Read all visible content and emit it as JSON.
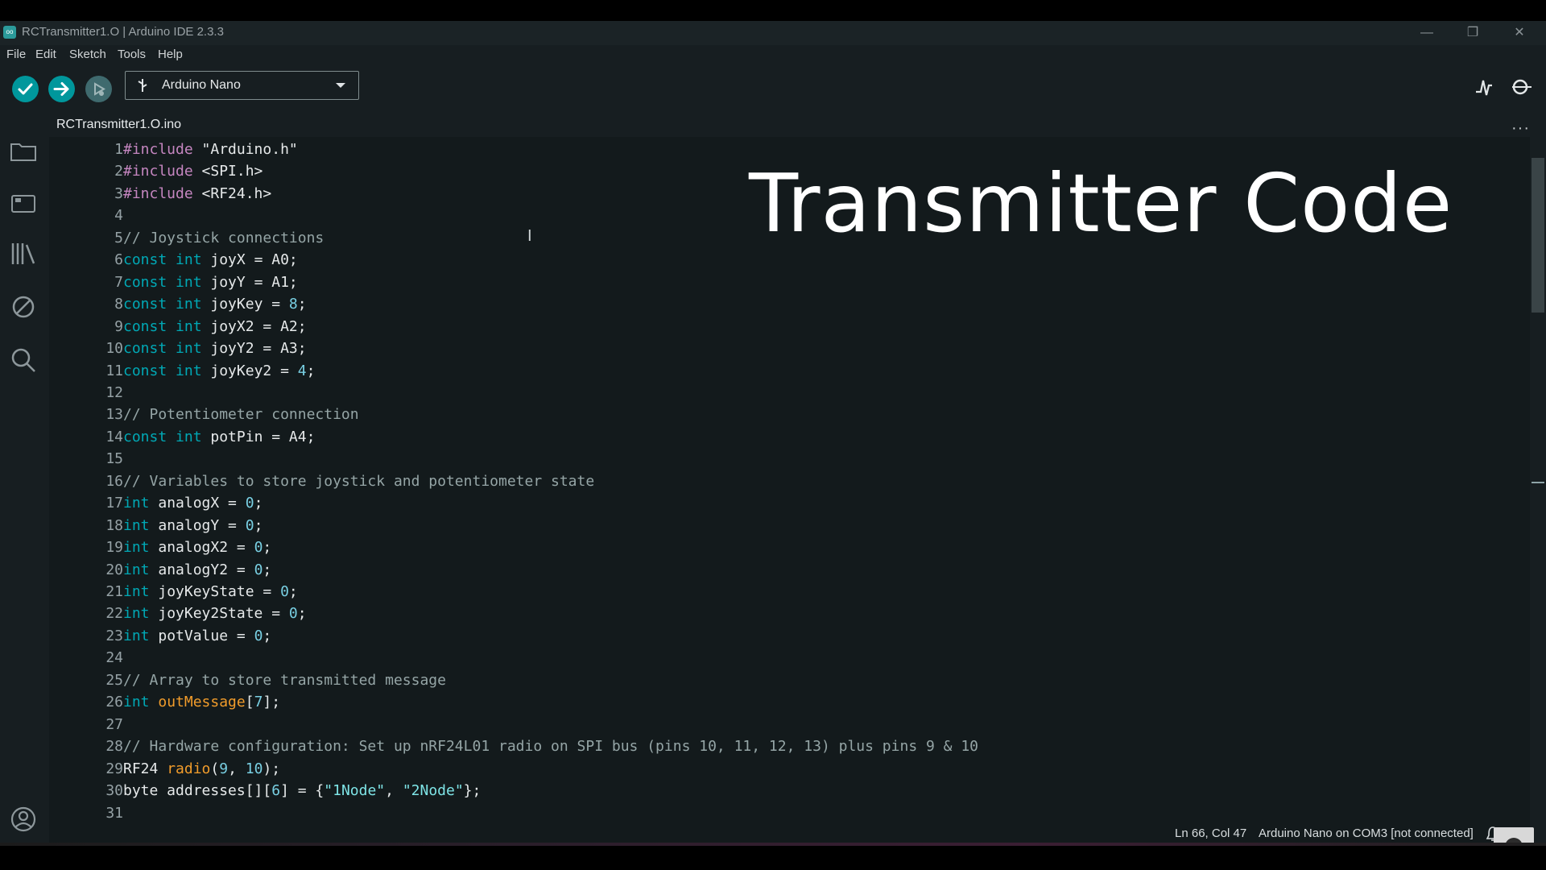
{
  "window": {
    "title": "RCTransmitter1.O | Arduino IDE 2.3.3",
    "logo_text": "oo",
    "controls": [
      "minimize",
      "restore",
      "close"
    ]
  },
  "menu": [
    "File",
    "Edit",
    "Sketch",
    "Tools",
    "Help"
  ],
  "toolbar": {
    "verify_icon": "check-icon",
    "upload_icon": "arrow-right-icon",
    "debug_icon": "debug-icon",
    "board": "Arduino Nano",
    "serial_plotter_icon": "serial-plotter-icon",
    "serial_monitor_icon": "serial-monitor-icon"
  },
  "sidebar": {
    "icons": [
      "folder-icon",
      "boards-manager-icon",
      "library-icon",
      "debug-disabled-icon",
      "search-icon",
      "account-icon"
    ]
  },
  "tab": {
    "label": "RCTransmitter1.O.ino"
  },
  "overlay": {
    "title": "Transmitter Code"
  },
  "editor": {
    "line_numbers": [
      "1",
      "2",
      "3",
      "4",
      "5",
      "6",
      "7",
      "8",
      "9",
      "10",
      "11",
      "12",
      "13",
      "14",
      "15",
      "16",
      "17",
      "18",
      "19",
      "20",
      "21",
      "22",
      "23",
      "24",
      "25",
      "26",
      "27",
      "28",
      "29",
      "30",
      "31"
    ],
    "lines": [
      [
        {
          "t": "#include",
          "c": "kw-pre"
        },
        {
          "t": " \"Arduino.h\"",
          "c": ""
        }
      ],
      [
        {
          "t": "#include",
          "c": "kw-pre"
        },
        {
          "t": " <SPI.h>",
          "c": ""
        }
      ],
      [
        {
          "t": "#include",
          "c": "kw-pre"
        },
        {
          "t": " <RF24.h>",
          "c": ""
        }
      ],
      [],
      [
        {
          "t": "// Joystick connections",
          "c": "com"
        }
      ],
      [
        {
          "t": "const int",
          "c": "kw-type"
        },
        {
          "t": " joyX = A0;",
          "c": ""
        }
      ],
      [
        {
          "t": "const int",
          "c": "kw-type"
        },
        {
          "t": " joyY = A1;",
          "c": ""
        }
      ],
      [
        {
          "t": "const int",
          "c": "kw-type"
        },
        {
          "t": " joyKey = ",
          "c": ""
        },
        {
          "t": "8",
          "c": "num"
        },
        {
          "t": ";",
          "c": ""
        }
      ],
      [
        {
          "t": "const int",
          "c": "kw-type"
        },
        {
          "t": " joyX2 = A2;",
          "c": ""
        }
      ],
      [
        {
          "t": "const int",
          "c": "kw-type"
        },
        {
          "t": " joyY2 = A3;",
          "c": ""
        }
      ],
      [
        {
          "t": "const int",
          "c": "kw-type"
        },
        {
          "t": " joyKey2 = ",
          "c": ""
        },
        {
          "t": "4",
          "c": "num"
        },
        {
          "t": ";",
          "c": ""
        }
      ],
      [],
      [
        {
          "t": "// Potentiometer connection",
          "c": "com"
        }
      ],
      [
        {
          "t": "const int",
          "c": "kw-type"
        },
        {
          "t": " potPin = A4;",
          "c": ""
        }
      ],
      [],
      [
        {
          "t": "// Variables to store joystick and potentiometer state",
          "c": "com"
        }
      ],
      [
        {
          "t": "int",
          "c": "kw-type"
        },
        {
          "t": " analogX = ",
          "c": ""
        },
        {
          "t": "0",
          "c": "num"
        },
        {
          "t": ";",
          "c": ""
        }
      ],
      [
        {
          "t": "int",
          "c": "kw-type"
        },
        {
          "t": " analogY = ",
          "c": ""
        },
        {
          "t": "0",
          "c": "num"
        },
        {
          "t": ";",
          "c": ""
        }
      ],
      [
        {
          "t": "int",
          "c": "kw-type"
        },
        {
          "t": " analogX2 = ",
          "c": ""
        },
        {
          "t": "0",
          "c": "num"
        },
        {
          "t": ";",
          "c": ""
        }
      ],
      [
        {
          "t": "int",
          "c": "kw-type"
        },
        {
          "t": " analogY2 = ",
          "c": ""
        },
        {
          "t": "0",
          "c": "num"
        },
        {
          "t": ";",
          "c": ""
        }
      ],
      [
        {
          "t": "int",
          "c": "kw-type"
        },
        {
          "t": " joyKeyState = ",
          "c": ""
        },
        {
          "t": "0",
          "c": "num"
        },
        {
          "t": ";",
          "c": ""
        }
      ],
      [
        {
          "t": "int",
          "c": "kw-type"
        },
        {
          "t": " joyKey2State = ",
          "c": ""
        },
        {
          "t": "0",
          "c": "num"
        },
        {
          "t": ";",
          "c": ""
        }
      ],
      [
        {
          "t": "int",
          "c": "kw-type"
        },
        {
          "t": " potValue = ",
          "c": ""
        },
        {
          "t": "0",
          "c": "num"
        },
        {
          "t": ";",
          "c": ""
        }
      ],
      [],
      [
        {
          "t": "// Array to store transmitted message",
          "c": "com"
        }
      ],
      [
        {
          "t": "int",
          "c": "kw-type"
        },
        {
          "t": " ",
          "c": ""
        },
        {
          "t": "outMessage",
          "c": "fn"
        },
        {
          "t": "[",
          "c": ""
        },
        {
          "t": "7",
          "c": "num"
        },
        {
          "t": "];",
          "c": ""
        }
      ],
      [],
      [
        {
          "t": "// Hardware configuration: Set up nRF24L01 radio on SPI bus (pins 10, 11, 12, 13) plus pins 9 & 10",
          "c": "com"
        }
      ],
      [
        {
          "t": "RF24 ",
          "c": ""
        },
        {
          "t": "radio",
          "c": "fn"
        },
        {
          "t": "(",
          "c": ""
        },
        {
          "t": "9",
          "c": "num"
        },
        {
          "t": ", ",
          "c": ""
        },
        {
          "t": "10",
          "c": "num"
        },
        {
          "t": ");",
          "c": ""
        }
      ],
      [
        {
          "t": "byte addresses[][",
          "c": ""
        },
        {
          "t": "6",
          "c": "num"
        },
        {
          "t": "] = {",
          "c": ""
        },
        {
          "t": "\"1Node\"",
          "c": "str"
        },
        {
          "t": ", ",
          "c": ""
        },
        {
          "t": "\"2Node\"",
          "c": "str"
        },
        {
          "t": "};",
          "c": ""
        }
      ],
      []
    ]
  },
  "status": {
    "position": "Ln 66, Col 47",
    "board_port": "Arduino Nano on COM3 [not connected]"
  },
  "colors": {
    "accent": "#00979c",
    "background": "#171e21",
    "editor_bg": "#131a1c"
  }
}
